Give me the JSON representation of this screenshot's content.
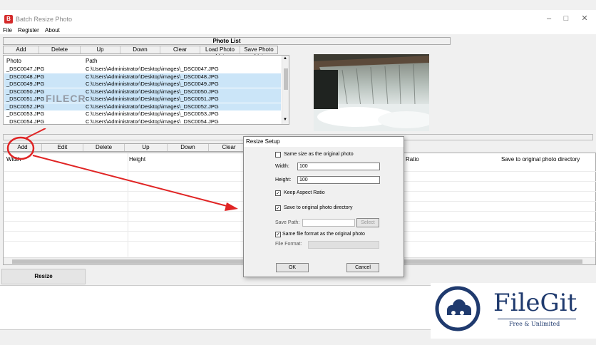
{
  "window": {
    "title": "Batch Resize Photo",
    "app_icon": "B"
  },
  "menu": [
    "File",
    "Register",
    "About"
  ],
  "photo_list": {
    "header": "Photo List",
    "toolbar": [
      "Add",
      "Delete",
      "Up",
      "Down",
      "Clear",
      "Load Photo List",
      "Save Photo List"
    ],
    "columns": [
      "Photo",
      "Path"
    ],
    "rows": [
      {
        "photo": "_DSC0047.JPG",
        "path": "C:\\Users\\Administrator\\Desktop\\images\\_DSC0047.JPG",
        "selected": false
      },
      {
        "photo": "_DSC0048.JPG",
        "path": "C:\\Users\\Administrator\\Desktop\\images\\_DSC0048.JPG",
        "selected": true
      },
      {
        "photo": "_DSC0049.JPG",
        "path": "C:\\Users\\Administrator\\Desktop\\images\\_DSC0049.JPG",
        "selected": true
      },
      {
        "photo": "_DSC0050.JPG",
        "path": "C:\\Users\\Administrator\\Desktop\\images\\_DSC0050.JPG",
        "selected": true
      },
      {
        "photo": "_DSC0051.JPG",
        "path": "C:\\Users\\Administrator\\Desktop\\images\\_DSC0051.JPG",
        "selected": true
      },
      {
        "photo": "_DSC0052.JPG",
        "path": "C:\\Users\\Administrator\\Desktop\\images\\_DSC0052.JPG",
        "selected": true
      },
      {
        "photo": "_DSC0053.JPG",
        "path": "C:\\Users\\Administrator\\Desktop\\images\\_DSC0053.JPG",
        "selected": false
      },
      {
        "photo": "_DSC0054.JPG",
        "path": "C:\\Users\\Administrator\\Desktop\\images\\_DSC0054.JPG",
        "selected": false
      }
    ]
  },
  "setup_list": {
    "toolbar": [
      "Add",
      "Edit",
      "Delete",
      "Up",
      "Down",
      "Clear"
    ],
    "columns": [
      "Width",
      "Height",
      "Ratio",
      "Save to original photo directory"
    ]
  },
  "dialog": {
    "title": "Resize Setup",
    "same_size_label": "Same size as the original photo",
    "same_size_checked": false,
    "width_label": "Width:",
    "width_value": "100",
    "height_label": "Height:",
    "height_value": "100",
    "keep_ratio_label": "Keep Aspect Ratio",
    "keep_ratio_checked": true,
    "save_original_label": "Save to original photo directory",
    "save_original_checked": true,
    "save_path_label": "Save Path:",
    "save_path_value": "",
    "select_label": "Select",
    "same_format_label": "Same file format as the original photo",
    "same_format_checked": true,
    "file_format_label": "File Format:",
    "ok_label": "OK",
    "cancel_label": "Cancel"
  },
  "resize_button": "Resize",
  "watermark": {
    "filecr": "FILECR",
    "brand": "FileGit",
    "tagline": "Free & Unlimited"
  },
  "colors": {
    "accent": "#d42a2a",
    "selection": "#cbe5f8",
    "logo_navy": "#1f3a6e"
  }
}
